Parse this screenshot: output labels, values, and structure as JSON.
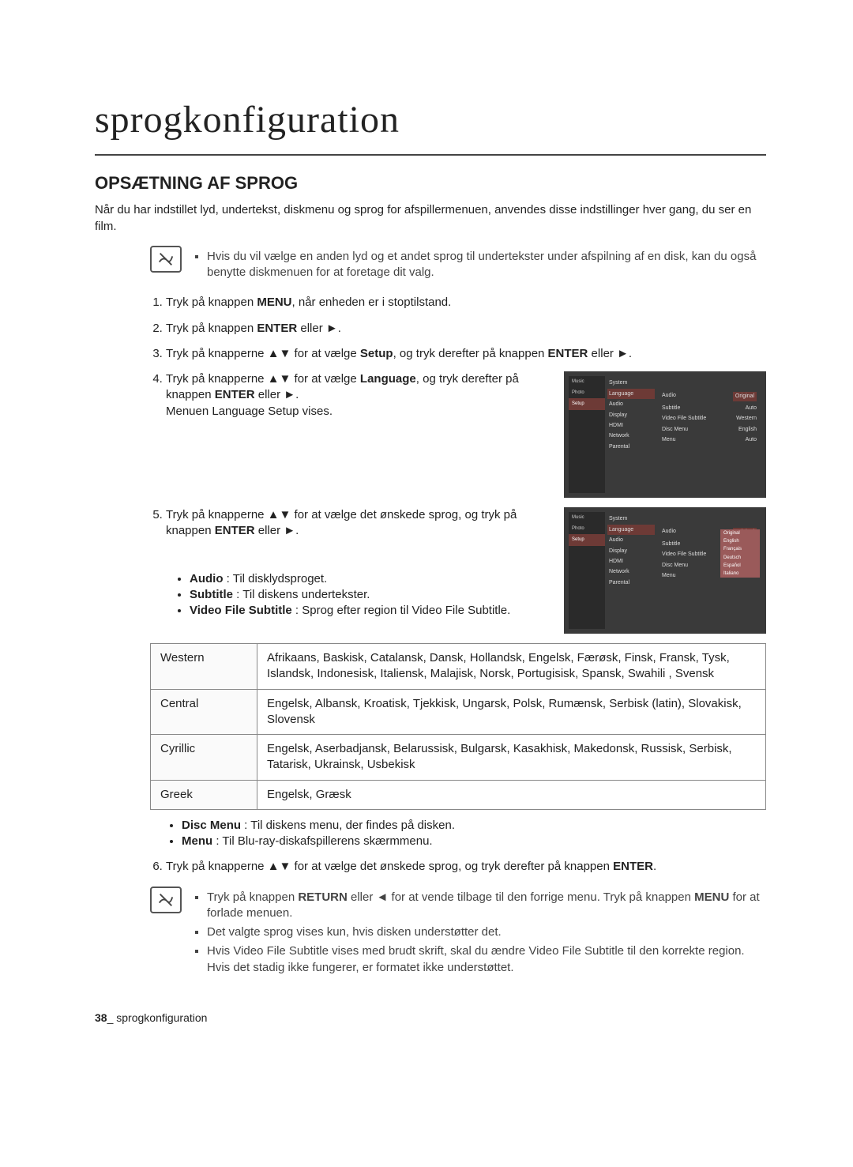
{
  "chapter_title": "sprogkonfiguration",
  "section_title": "OPSÆTNING AF SPROG",
  "intro": "Når du har indstillet lyd, undertekst, diskmenu og sprog for afspillermenuen, anvendes disse indstillinger hver gang, du ser en film.",
  "note1": "Hvis du vil vælge en anden lyd og et andet sprog til undertekster under afspilning af en disk, kan du også benytte diskmenuen for at foretage dit valg.",
  "steps": {
    "s1_a": "Tryk på knappen ",
    "s1_b": "MENU",
    "s1_c": ", når enheden er i stoptilstand.",
    "s2_a": "Tryk på knappen ",
    "s2_b": "ENTER",
    "s2_c": " eller ►.",
    "s3_a": "Tryk på knapperne ▲▼ for at vælge ",
    "s3_b": "Setup",
    "s3_c": ", og tryk derefter på knappen ",
    "s3_d": "ENTER",
    "s3_e": " eller ►.",
    "s4_a": "Tryk på knapperne ▲▼ for at vælge ",
    "s4_b": "Language",
    "s4_c": ", og tryk derefter på knappen ",
    "s4_d": "ENTER",
    "s4_e": " eller ►.",
    "s4_f": "Menuen Language Setup vises.",
    "s5_a": "Tryk på knapperne ▲▼ for at vælge det ønskede sprog, og tryk på knappen ",
    "s5_b": "ENTER",
    "s5_c": " eller ►.",
    "s6_a": "Tryk på knapperne ▲▼ for at vælge det ønskede sprog, og tryk derefter på knappen ",
    "s6_b": "ENTER",
    "s6_c": "."
  },
  "bul": {
    "audio_k": "Audio",
    "audio_v": " : Til disklydsproget.",
    "sub_k": "Subtitle",
    "sub_v": " : Til diskens undertekster.",
    "vfs_k": "Video File Subtitle",
    "vfs_v": " : Sprog efter region til Video File Subtitle.",
    "dm_k": "Disc Menu",
    "dm_v": " : Til diskens menu, der findes på disken.",
    "menu_k": "Menu",
    "menu_v": " : Til Blu-ray-diskafspillerens skærmmenu."
  },
  "table": {
    "r1k": "Western",
    "r1v": "Afrikaans, Baskisk, Catalansk, Dansk, Hollandsk, Engelsk, Færøsk, Finsk, Fransk, Tysk, Islandsk, Indonesisk, Italiensk, Malajisk, Norsk, Portugisisk, Spansk, Swahili , Svensk",
    "r2k": "Central",
    "r2v": "Engelsk, Albansk, Kroatisk, Tjekkisk, Ungarsk, Polsk, Rumænsk, Serbisk (latin), Slovakisk, Slovensk",
    "r3k": "Cyrillic",
    "r3v": "Engelsk, Aserbadjansk, Belarussisk, Bulgarsk, Kasakhisk, Makedonsk, Russisk, Serbisk, Tatarisk, Ukrainsk, Usbekisk",
    "r4k": "Greek",
    "r4v": "Engelsk, Græsk"
  },
  "note2": {
    "n1a": "Tryk på knappen ",
    "n1b": "RETURN",
    "n1c": " eller ◄ for at vende tilbage til den forrige menu. Tryk på knappen ",
    "n1d": "MENU",
    "n1e": " for at forlade menuen.",
    "n2": "Det valgte sprog vises kun, hvis disken understøtter det.",
    "n3": "Hvis Video File Subtitle vises med brudt skrift, skal du ændre Video File Subtitle til den korrekte region. Hvis det stadig ikke fungerer, er formatet ikke understøttet."
  },
  "thumb": {
    "sb_music": "Music",
    "sb_photo": "Photo",
    "sb_setup": "Setup",
    "m_system": "System",
    "m_language": "Language",
    "m_audio": "Audio",
    "m_display": "Display",
    "m_hdmi": "HDMI",
    "m_network": "Network",
    "m_parental": "Parental",
    "k_audio": "Audio",
    "v_orig": "Original",
    "k_sub": "Subtitle",
    "v_auto": "Auto",
    "k_vfs": "Video File Subtitle",
    "v_west": "Western",
    "k_dm": "Disc Menu",
    "v_eng": "English",
    "k_menu": "Menu",
    "dd": {
      "o1": "Original",
      "o2": "English",
      "o3": "Français",
      "o4": "Deutsch",
      "o5": "Español",
      "o6": "Italiano"
    }
  },
  "footer_page": "38",
  "footer_sep": "_ ",
  "footer_label": "sprogkonfiguration"
}
